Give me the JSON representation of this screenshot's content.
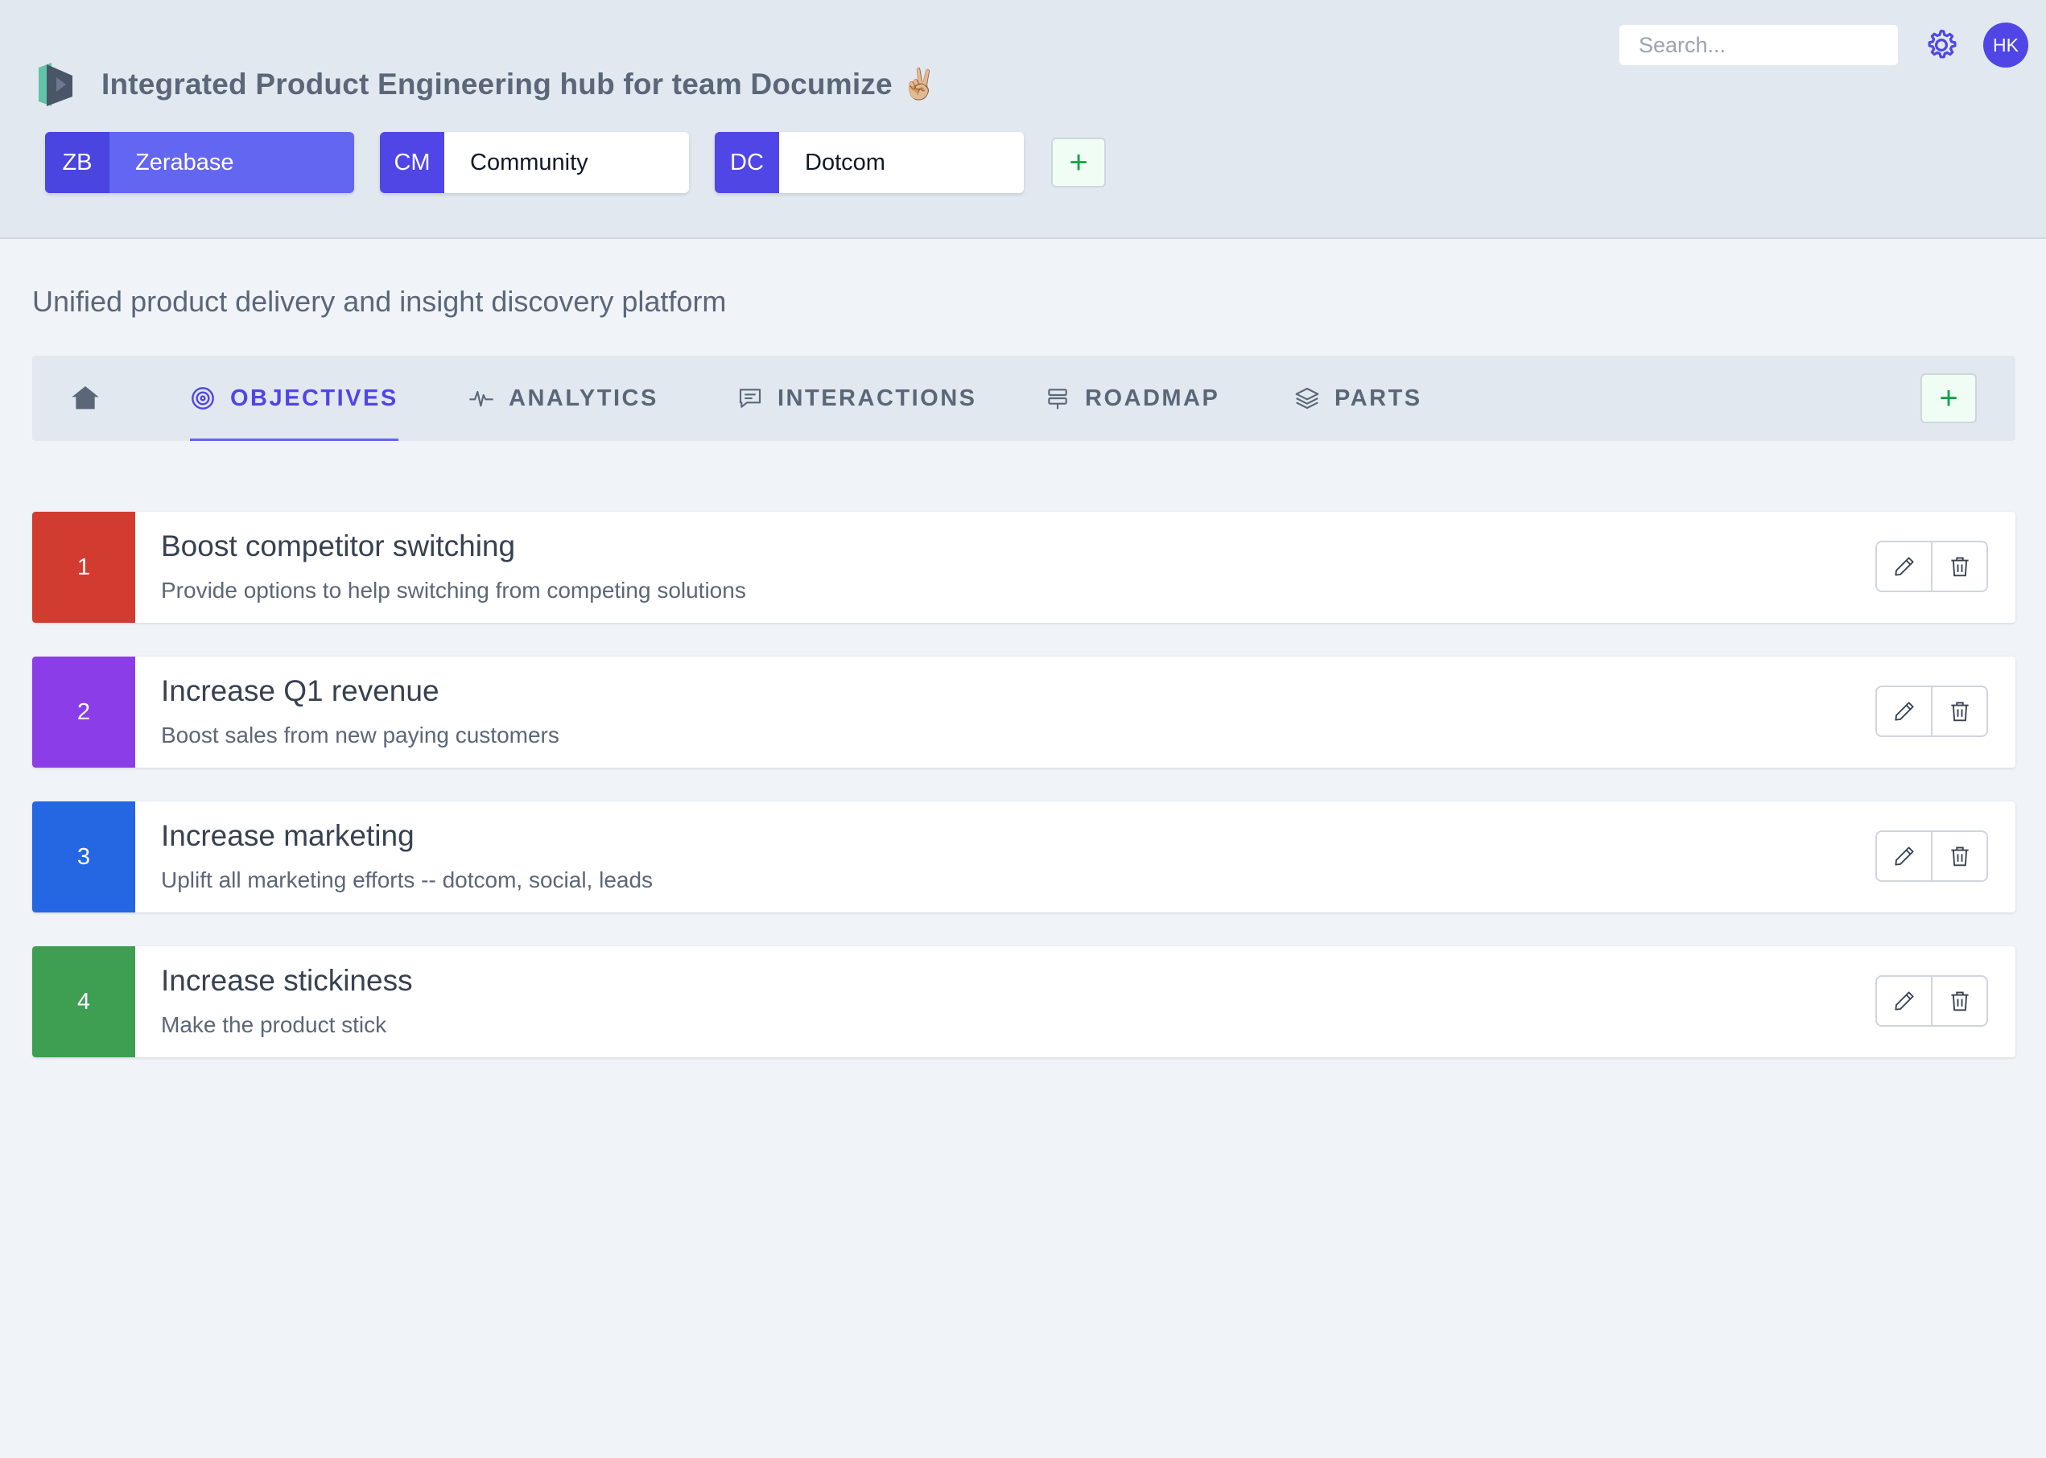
{
  "window": {
    "controls": [
      "close",
      "minimize",
      "zoom"
    ]
  },
  "header": {
    "title": "Integrated Product Engineering hub for team Documize ✌🏼",
    "search_placeholder": "Search...",
    "avatar_initials": "HK",
    "accent": "#4f46e5"
  },
  "spaces": [
    {
      "code": "ZB",
      "name": "Zerabase",
      "active": true
    },
    {
      "code": "CM",
      "name": "Community",
      "active": false
    },
    {
      "code": "DC",
      "name": "Dotcom",
      "active": false
    }
  ],
  "add_space_label": "+",
  "subtitle": "Unified product delivery and insight discovery platform",
  "tabs": [
    {
      "label": "",
      "icon": "home-icon"
    },
    {
      "label": "OBJECTIVES",
      "icon": "target-icon",
      "active": true
    },
    {
      "label": "ANALYTICS",
      "icon": "pulse-icon"
    },
    {
      "label": "INTERACTIONS",
      "icon": "chat-icon"
    },
    {
      "label": "ROADMAP",
      "icon": "signpost-icon"
    },
    {
      "label": "PARTS",
      "icon": "layers-icon"
    }
  ],
  "add_tab_label": "+",
  "objectives": [
    {
      "number": "1",
      "title": "Boost competitor switching",
      "description": "Provide options to help switching from competing solutions",
      "color": "#d23b2f"
    },
    {
      "number": "2",
      "title": "Increase Q1 revenue",
      "description": "Boost sales from new paying customers",
      "color": "#8b3ee8"
    },
    {
      "number": "3",
      "title": "Increase marketing",
      "description": "Uplift all marketing efforts -- dotcom, social, leads",
      "color": "#2566e3"
    },
    {
      "number": "4",
      "title": "Increase stickiness",
      "description": "Make the product stick",
      "color": "#3e9e52"
    }
  ],
  "row_actions": {
    "edit_icon": "pencil-icon",
    "delete_icon": "trash-icon"
  }
}
